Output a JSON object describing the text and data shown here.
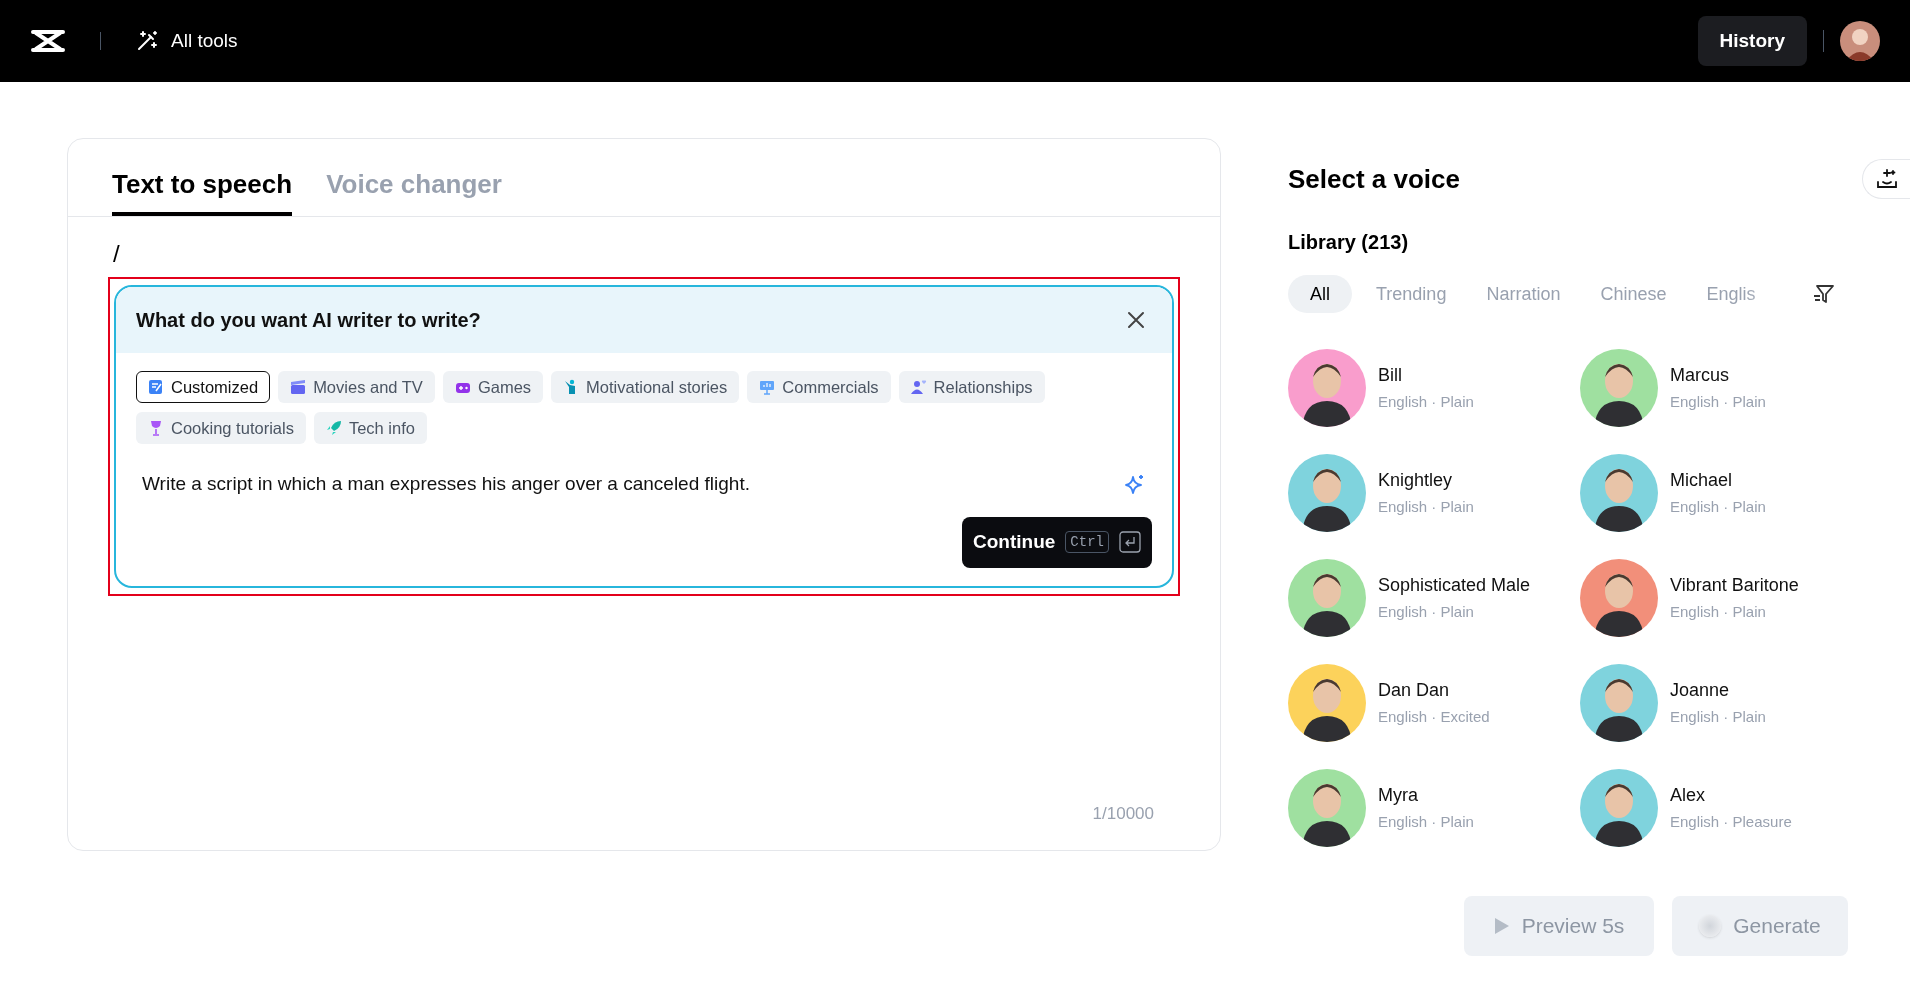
{
  "top_bar": {
    "tools_label": "All tools",
    "history_button": "History"
  },
  "editor": {
    "tabs": [
      {
        "label": "Text to speech",
        "selected": true
      },
      {
        "label": "Voice changer",
        "selected": false
      }
    ],
    "typed_text": "/",
    "ai_writer": {
      "title": "What do you want AI writer to write?",
      "chips": [
        {
          "label": "Customized",
          "selected": true
        },
        {
          "label": "Movies and TV",
          "selected": false
        },
        {
          "label": "Games",
          "selected": false
        },
        {
          "label": "Motivational stories",
          "selected": false
        },
        {
          "label": "Commercials",
          "selected": false
        },
        {
          "label": "Relationships",
          "selected": false
        },
        {
          "label": "Cooking tutorials",
          "selected": false
        },
        {
          "label": "Tech info",
          "selected": false
        }
      ],
      "prompt": "Write a script in which a man expresses his anger over a canceled flight.",
      "continue_button": {
        "label": "Continue",
        "shortcut": "Ctrl"
      }
    },
    "char_count": "1/10000"
  },
  "voice_panel": {
    "title": "Select a voice",
    "library_label": "Library (213)",
    "filters": [
      {
        "label": "All",
        "selected": true
      },
      {
        "label": "Trending",
        "selected": false
      },
      {
        "label": "Narration",
        "selected": false
      },
      {
        "label": "Chinese",
        "selected": false
      },
      {
        "label": "Englis",
        "selected": false
      }
    ],
    "voices": [
      {
        "name": "Bill",
        "details": "English · Plain",
        "color": "#f99dcc"
      },
      {
        "name": "Marcus",
        "details": "English · Plain",
        "color": "#9fe0a0"
      },
      {
        "name": "Knightley",
        "details": "English · Plain",
        "color": "#7fd3dd"
      },
      {
        "name": "Michael",
        "details": "English · Plain",
        "color": "#7fd3dd"
      },
      {
        "name": "Sophisticated Male",
        "details": "English · Plain",
        "color": "#9fe0a0"
      },
      {
        "name": "Vibrant Baritone",
        "details": "English · Plain",
        "color": "#f28f7a"
      },
      {
        "name": "Dan Dan",
        "details": "English · Excited",
        "color": "#fcd25b"
      },
      {
        "name": "Joanne",
        "details": "English · Plain",
        "color": "#7fd3dd"
      },
      {
        "name": "Myra",
        "details": "English · Plain",
        "color": "#9fe0a0"
      },
      {
        "name": "Alex",
        "details": "English · Pleasure",
        "color": "#7fd3dd"
      }
    ],
    "preview_button": {
      "label": "Preview 5s",
      "disabled": true
    },
    "generate_button": {
      "label": "Generate",
      "disabled": true
    }
  }
}
